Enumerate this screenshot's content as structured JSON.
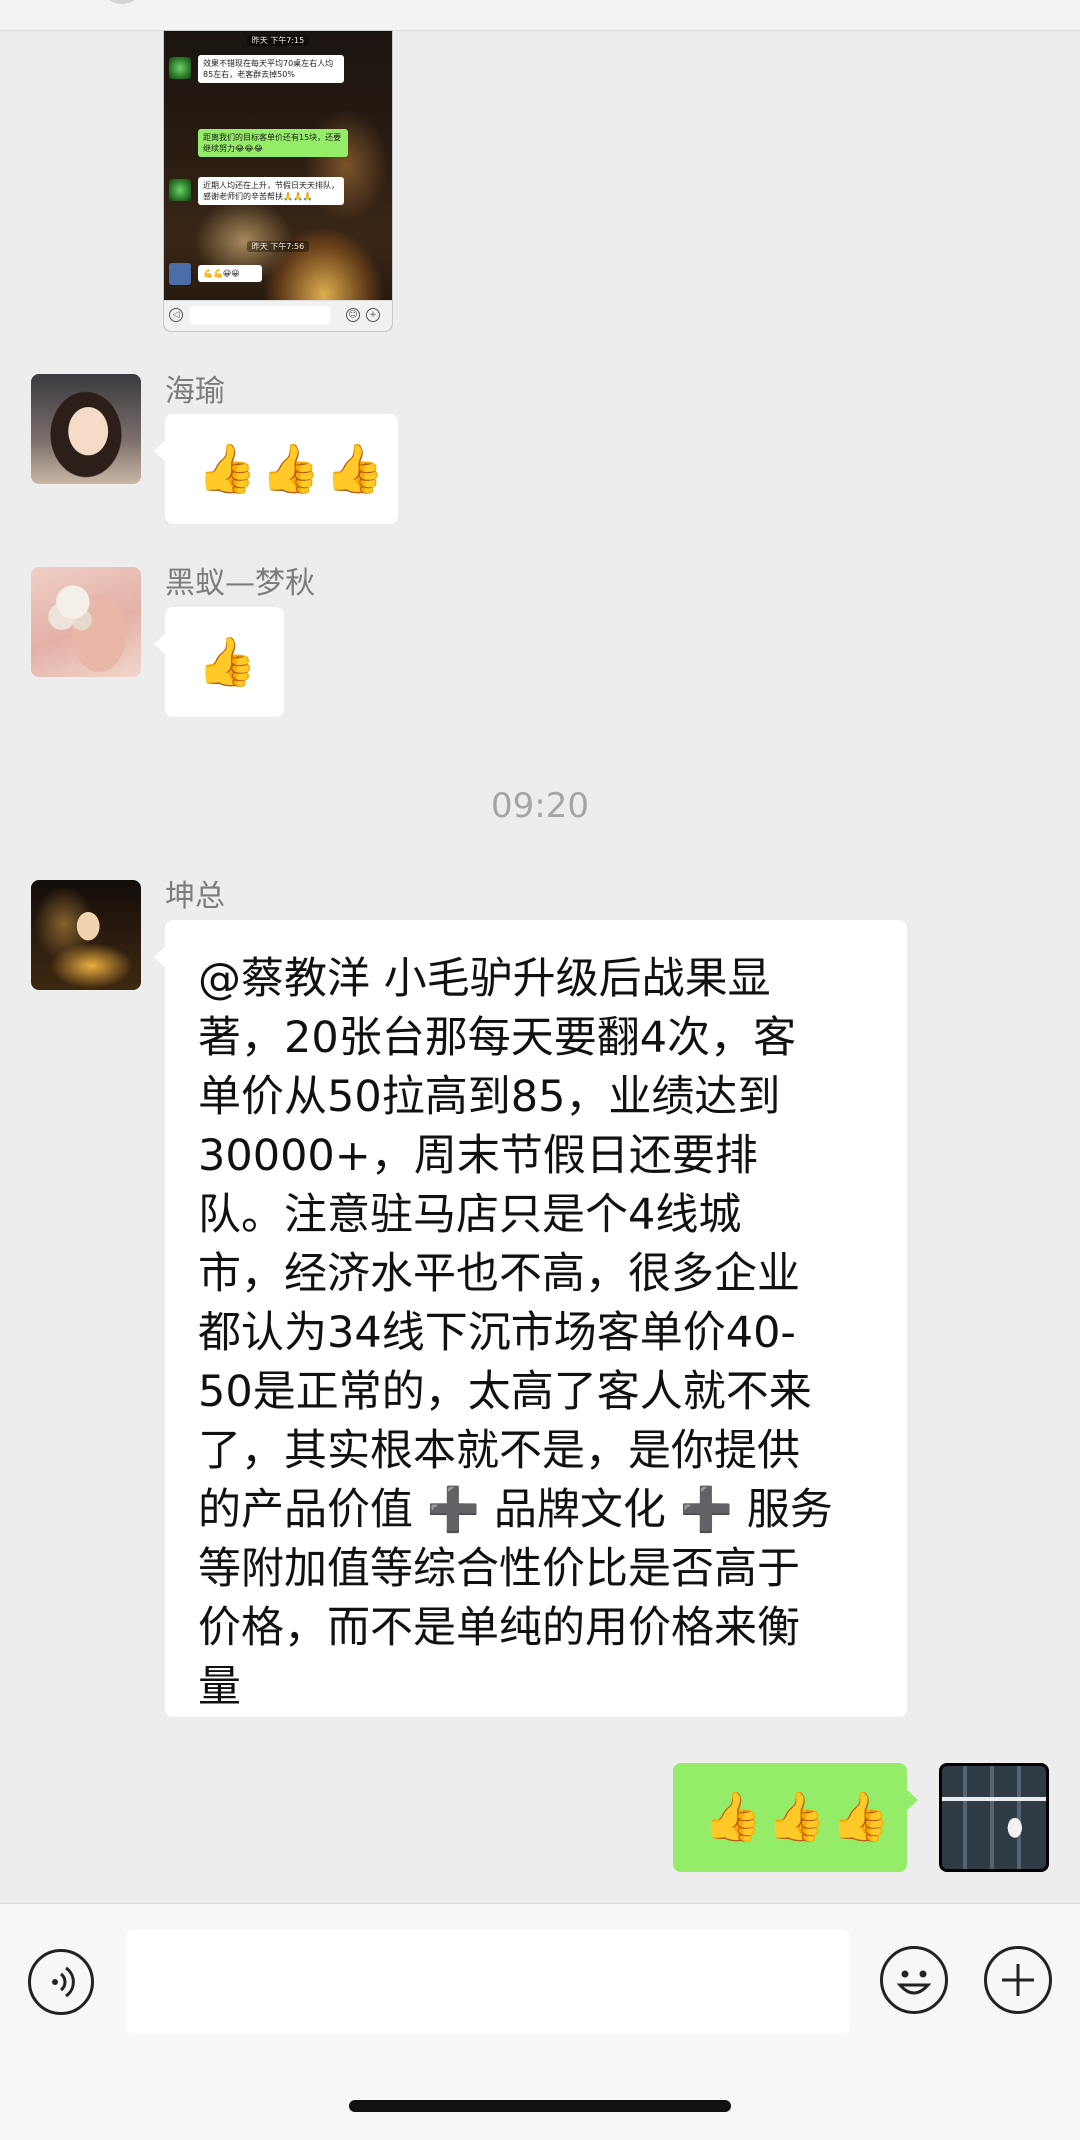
{
  "shared_screenshot": {
    "timestamp_1": "昨天 下午7:15",
    "message_1": "效果不错现在每天平均70桌左右人均85左右，老客群去掉50%",
    "message_2": "距离我们的目标客单价还有15块，还要继续努力😂😂😂",
    "message_3": "近期人均还在上升，节假日天天排队，感谢老师们的辛苦帮扶🙏🙏🙏",
    "timestamp_2": "昨天 下午7:56",
    "message_4": "💪💪😀😀"
  },
  "messages": [
    {
      "sender": "海瑜",
      "content": "👍👍👍"
    },
    {
      "sender": "黑蚁—梦秋",
      "content": "👍"
    },
    {
      "sender": "坤总",
      "content": "@蔡教洋 小毛驴升级后战果显\n著，20张台那每天要翻4次，客\n单价从50拉高到85，业绩达到\n30000+，周末节假日还要排\n队。注意驻马店只是个4线城\n市，经济水平也不高，很多企业\n都认为34线下沉市场客单价40-\n50是正常的，太高了客人就不来\n了，其实根本就不是，是你提供\n的产品价值 ➕ 品牌文化 ➕ 服务\n等附加值等综合性价比是否高于\n价格，而不是单纯的用价格来衡\n量"
    },
    {
      "sender": "me",
      "content": "👍👍👍"
    }
  ],
  "time_divider": "09:20",
  "input_bar": {
    "voice_icon": "voice-icon",
    "emoji_icon": "emoji-icon",
    "plus_icon": "plus-icon",
    "value": ""
  },
  "colors": {
    "background": "#ededed",
    "my_bubble": "#95ec69",
    "other_bubble": "#ffffff",
    "name_text": "#7d7d7d"
  }
}
